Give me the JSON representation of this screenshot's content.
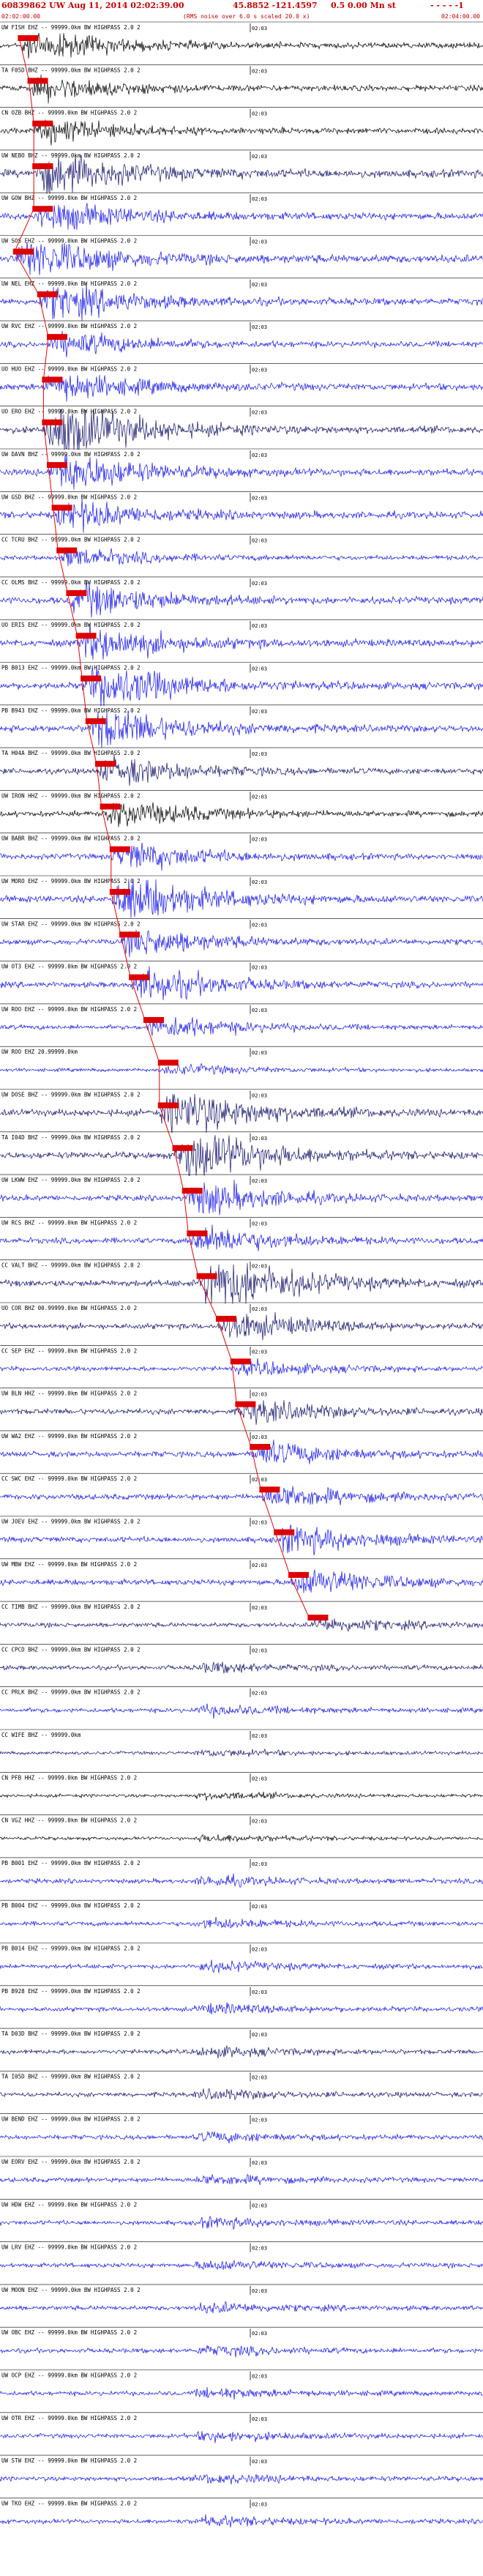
{
  "header": {
    "title": "60839862 UW Aug 11, 2014 02:02:39.00",
    "coords": "45.8852 -121.4597",
    "magnitude": "0.5 0.00 Mn st",
    "dash_tail": "- - - - -1",
    "start_time": "02:02:00.00",
    "end_time": "02:04:00.00",
    "subtitle": "(RMS noise over 6.0 s scaled 20.0 x)",
    "title_color": "#cc0000"
  },
  "chart_data": {
    "type": "seismogram",
    "title": "60839862 UW Aug 11, 2014 02:02:39.00",
    "time_window": [
      "02:02:00.00",
      "02:04:00.00"
    ],
    "tick_label": "02:03",
    "colors": {
      "black": "#000000",
      "blue": "#1212ee",
      "navy": "#10106a",
      "pick": "#dd0000",
      "tick": "#000000",
      "travel_time": "#ee0000"
    },
    "traces": [
      {
        "label": "UW FISH EHZ -- 99999.0km BW HIGHPASS 2.0 2",
        "color": "black",
        "amp": 0.25,
        "pick": 0.04,
        "event": 0.5
      },
      {
        "label": "TA F05D BHZ -- 99999.0km BW HIGHPASS 2.0 2",
        "color": "black",
        "amp": 0.25,
        "pick": 0.06,
        "event": 0.4
      },
      {
        "label": "CN OZB BHZ -- 99999.0km BW HIGHPASS 2.0 2",
        "color": "black",
        "amp": 0.25,
        "pick": 0.07,
        "event": 0.4
      },
      {
        "label": "UW NEBO BHZ -- 99999.0km BW HIGHPASS 2.0 2",
        "color": "navy",
        "amp": 0.35,
        "pick": 0.07,
        "event": 0.5
      },
      {
        "label": "UW GOW BHZ -- 99999.0km BW HIGHPASS 2.0 2",
        "color": "blue",
        "amp": 0.3,
        "pick": 0.07,
        "event": 0.4
      },
      {
        "label": "UW SOS EHZ -- 99999.0km BW HIGHPASS 2.0 2",
        "color": "blue",
        "amp": 0.35,
        "pick": 0.03,
        "event": 0.5
      },
      {
        "label": "UW NEL EHZ -- 99999.0km BW HIGHPASS 2.0 2",
        "color": "blue",
        "amp": 0.3,
        "pick": 0.08,
        "event": 0.5
      },
      {
        "label": "UW RVC EHZ -- 99999.0km BW HIGHPASS 2.0 2",
        "color": "blue",
        "amp": 0.25,
        "pick": 0.1,
        "event": 0.4
      },
      {
        "label": "UO HUO EHZ -- 99999.0km BW HIGHPASS 2.0 2",
        "color": "blue",
        "amp": 0.3,
        "pick": 0.09,
        "event": 0.4
      },
      {
        "label": "UO ERO EHZ -- 99999.0km BW HIGHPASS 2.0 2",
        "color": "navy",
        "amp": 0.3,
        "pick": 0.09,
        "event": 0.9
      },
      {
        "label": "UW DAVN BHZ -- 99999.0km BW HIGHPASS 2.0 2",
        "color": "blue",
        "amp": 0.3,
        "pick": 0.1,
        "event": 0.6
      },
      {
        "label": "UW GSD BHZ -- 99999.0km BW HIGHPASS 2.0 2",
        "color": "blue",
        "amp": 0.3,
        "pick": 0.11,
        "event": 0.4
      },
      {
        "label": "CC TCRU BHZ -- 99999.0km BW HIGHPASS 2.0 2",
        "color": "blue",
        "amp": 0.2,
        "pick": 0.12,
        "event": 0.4
      },
      {
        "label": "CC OLMS BHZ -- 99999.0km BW HIGHPASS 2.0 2",
        "color": "blue",
        "amp": 0.3,
        "pick": 0.14,
        "event": 0.5
      },
      {
        "label": "UO ERIS EHZ -- 99999.0km BW HIGHPASS 2.0 2",
        "color": "blue",
        "amp": 0.3,
        "pick": 0.16,
        "event": 0.5
      },
      {
        "label": "PB B013 EHZ -- 99999.0km BW HIGHPASS 2.0 2",
        "color": "blue",
        "amp": 0.3,
        "pick": 0.17,
        "event": 0.7
      },
      {
        "label": "PB B943 EHZ -- 99999.0km BW HIGHPASS 2.0 2",
        "color": "blue",
        "amp": 0.3,
        "pick": 0.18,
        "event": 0.6
      },
      {
        "label": "TA H04A BHZ -- 99999.0km BW HIGHPASS 2.0 2",
        "color": "navy",
        "amp": 0.25,
        "pick": 0.2,
        "event": 0.5
      },
      {
        "label": "UW IRON HHZ -- 99999.0km BW HIGHPASS 2.0 2",
        "color": "black",
        "amp": 0.25,
        "pick": 0.21,
        "event": 0.5
      },
      {
        "label": "UW BABR BHZ -- 99999.0km BW HIGHPASS 2.0 2",
        "color": "blue",
        "amp": 0.25,
        "pick": 0.23,
        "event": 0.5
      },
      {
        "label": "UW MORO EHZ -- 99999.0km BW HIGHPASS 2.0 2",
        "color": "blue",
        "amp": 0.3,
        "pick": 0.23,
        "event": 0.7
      },
      {
        "label": "UW STAR EHZ -- 99999.0km BW HIGHPASS 2.0 2",
        "color": "blue",
        "amp": 0.25,
        "pick": 0.25,
        "event": 0.5
      },
      {
        "label": "UW OT3 EHZ -- 99999.0km BW HIGHPASS 2.0 2",
        "color": "blue",
        "amp": 0.25,
        "pick": 0.27,
        "event": 0.6
      },
      {
        "label": "UW ROO EHZ -- 99999.0km BW HIGHPASS 2.0 2",
        "color": "blue",
        "amp": 0.2,
        "pick": 0.3,
        "event": 0.5
      },
      {
        "label": "UW ROO EHZ 20.99999.0km",
        "color": "blue",
        "amp": 0.15,
        "pick": 0.33,
        "event": 0.3
      },
      {
        "label": "UW DOSE BHZ -- 99999.0km BW HIGHPASS 2.0 2",
        "color": "navy",
        "amp": 0.3,
        "pick": 0.33,
        "event": 0.7
      },
      {
        "label": "TA I04D BHZ -- 99999.0km BW HIGHPASS 2.0 2",
        "color": "navy",
        "amp": 0.3,
        "pick": 0.36,
        "event": 0.8
      },
      {
        "label": "UW LKWW EHZ -- 99999.0km BW HIGHPASS 2.0 2",
        "color": "blue",
        "amp": 0.25,
        "pick": 0.38,
        "event": 0.6
      },
      {
        "label": "UW RCS BHZ -- 99999.0km BW HIGHPASS 2.0 2",
        "color": "blue",
        "amp": 0.25,
        "pick": 0.39,
        "event": 0.5
      },
      {
        "label": "CC VALT BHZ -- 99999.0km BW HIGHPASS 2.0 2",
        "color": "navy",
        "amp": 0.3,
        "pick": 0.41,
        "event": 0.9
      },
      {
        "label": "UO COR BHZ 00.99999.0km BW HIGHPASS 2.0 2",
        "color": "navy",
        "amp": 0.25,
        "pick": 0.45,
        "event": 0.5
      },
      {
        "label": "CC SEP EHZ -- 99999.0km BW HIGHPASS 2.0 2",
        "color": "blue",
        "amp": 0.2,
        "pick": 0.48,
        "event": 0.3
      },
      {
        "label": "UW BLN HHZ -- 99999.0km BW HIGHPASS 2.0 2",
        "color": "navy",
        "amp": 0.25,
        "pick": 0.49,
        "event": 0.4
      },
      {
        "label": "UW WA2 EHZ -- 99999.0km BW HIGHPASS 2.0 2",
        "color": "blue",
        "amp": 0.25,
        "pick": 0.52,
        "event": 0.4
      },
      {
        "label": "CC SWC EHZ -- 99999.0km BW HIGHPASS 2.0 2",
        "color": "blue",
        "amp": 0.25,
        "pick": 0.54,
        "event": 0.4
      },
      {
        "label": "UW JOEV EHZ -- 99999.0km BW HIGHPASS 2.0 2",
        "color": "blue",
        "amp": 0.25,
        "pick": 0.57,
        "event": 0.5
      },
      {
        "label": "UW MBW EHZ -- 99999.0km BW HIGHPASS 2.0 2",
        "color": "blue",
        "amp": 0.25,
        "pick": 0.6,
        "event": 0.5
      },
      {
        "label": "CC TIMB BHZ -- 99999.0km BW HIGHPASS 2.0 2",
        "color": "navy",
        "amp": 0.2,
        "pick": 0.64,
        "event": 0.3
      },
      {
        "label": "CC CPCD BHZ -- 99999.0km BW HIGHPASS 2.0 2",
        "color": "navy",
        "amp": 0.2,
        "pick": null,
        "event": 0.2
      },
      {
        "label": "CC PRLK BHZ -- 99999.0km BW HIGHPASS 2.0 2",
        "color": "blue",
        "amp": 0.2,
        "pick": null,
        "event": 0.2
      },
      {
        "label": "CC WIFE BHZ -- 99999.0km",
        "color": "navy",
        "amp": 0.15,
        "pick": null,
        "event": 0.2
      },
      {
        "label": "CN PFB HHZ -- 99999.0km BW HIGHPASS 2.0 2",
        "color": "black",
        "amp": 0.15,
        "pick": null,
        "event": 0.2
      },
      {
        "label": "CN VGZ HHZ -- 99999.0km BW HIGHPASS 2.0 2",
        "color": "black",
        "amp": 0.15,
        "pick": null,
        "event": 0.2
      },
      {
        "label": "PB B001 EHZ -- 99999.0km BW HIGHPASS 2.0 2",
        "color": "blue",
        "amp": 0.2,
        "pick": null,
        "event": 0.2
      },
      {
        "label": "PB B004 EHZ -- 99999.0km BW HIGHPASS 2.0 2",
        "color": "blue",
        "amp": 0.2,
        "pick": null,
        "event": 0.2
      },
      {
        "label": "PB B014 EHZ -- 99999.0km BW HIGHPASS 2.0 2",
        "color": "blue",
        "amp": 0.2,
        "pick": null,
        "event": 0.2
      },
      {
        "label": "PB B928 EHZ -- 99999.0km BW HIGHPASS 2.0 2",
        "color": "blue",
        "amp": 0.2,
        "pick": null,
        "event": 0.2
      },
      {
        "label": "TA D03D BHZ -- 99999.0km BW HIGHPASS 2.0 2",
        "color": "navy",
        "amp": 0.2,
        "pick": null,
        "event": 0.2
      },
      {
        "label": "TA I05D BHZ -- 99999.0km BW HIGHPASS 2.0 2",
        "color": "navy",
        "amp": 0.2,
        "pick": null,
        "event": 0.2
      },
      {
        "label": "UW BEND EHZ -- 99999.0km BW HIGHPASS 2.0 2",
        "color": "blue",
        "amp": 0.2,
        "pick": null,
        "event": 0.2
      },
      {
        "label": "UW EORV EHZ -- 99999.0km BW HIGHPASS 2.0 2",
        "color": "blue",
        "amp": 0.2,
        "pick": null,
        "event": 0.2
      },
      {
        "label": "UW HDW EHZ -- 99999.0km BW HIGHPASS 2.0 2",
        "color": "blue",
        "amp": 0.2,
        "pick": null,
        "event": 0.2
      },
      {
        "label": "UW LRV EHZ -- 99999.0km BW HIGHPASS 2.0 2",
        "color": "blue",
        "amp": 0.2,
        "pick": null,
        "event": 0.2
      },
      {
        "label": "UW MOON EHZ -- 99999.0km BW HIGHPASS 2.0 2",
        "color": "blue",
        "amp": 0.2,
        "pick": null,
        "event": 0.2
      },
      {
        "label": "UW OBC EHZ -- 99999.0km BW HIGHPASS 2.0 2",
        "color": "blue",
        "amp": 0.2,
        "pick": null,
        "event": 0.2
      },
      {
        "label": "UW OCP EHZ -- 99999.0km BW HIGHPASS 2.0 2",
        "color": "blue",
        "amp": 0.2,
        "pick": null,
        "event": 0.2
      },
      {
        "label": "UW OTR EHZ -- 99999.0km BW HIGHPASS 2.0 2",
        "color": "blue",
        "amp": 0.2,
        "pick": null,
        "event": 0.2
      },
      {
        "label": "UW STW EHZ -- 99999.0km BW HIGHPASS 2.0 2",
        "color": "blue",
        "amp": 0.2,
        "pick": null,
        "event": 0.2
      },
      {
        "label": "UW TKO EHZ -- 99999.0km BW HIGHPASS 2.0 2",
        "color": "blue",
        "amp": 0.2,
        "pick": null,
        "event": 0.2
      }
    ]
  }
}
